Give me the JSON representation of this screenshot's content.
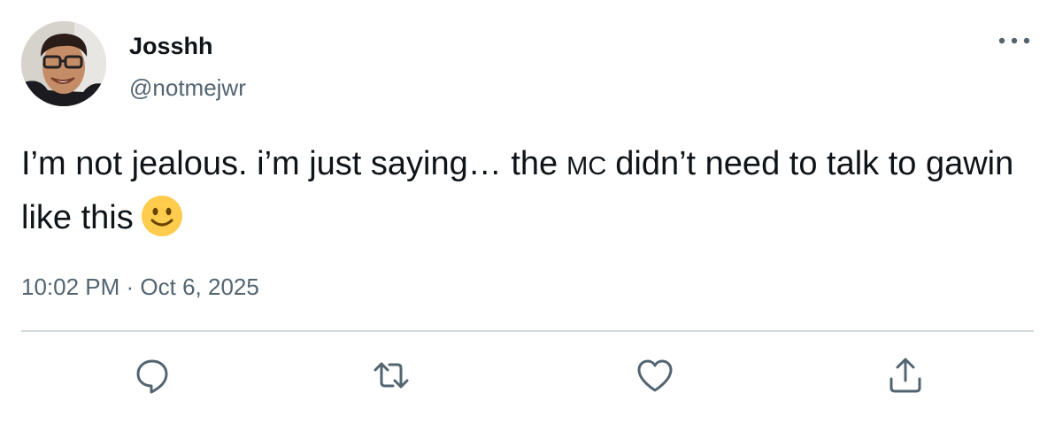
{
  "author": {
    "display_name": "Josshh",
    "handle": "@notmejwr",
    "avatar_icon": "profile-photo"
  },
  "tweet": {
    "text_part1": "I’m not jealous. i’m just saying… the",
    "tag": "MC",
    "text_part2": "didn’t need to talk to gawin like this",
    "emoji_icon": "slightly-smiling-face-icon"
  },
  "meta": {
    "time": "10:02 PM",
    "separator": " · ",
    "date": "Oct 6, 2025"
  },
  "actions": {
    "reply_icon": "reply-icon",
    "retweet_icon": "retweet-icon",
    "like_icon": "heart-icon",
    "share_icon": "share-icon"
  },
  "colors": {
    "text_primary": "#0f1419",
    "text_secondary": "#536471",
    "divider": "#cfd9de"
  }
}
